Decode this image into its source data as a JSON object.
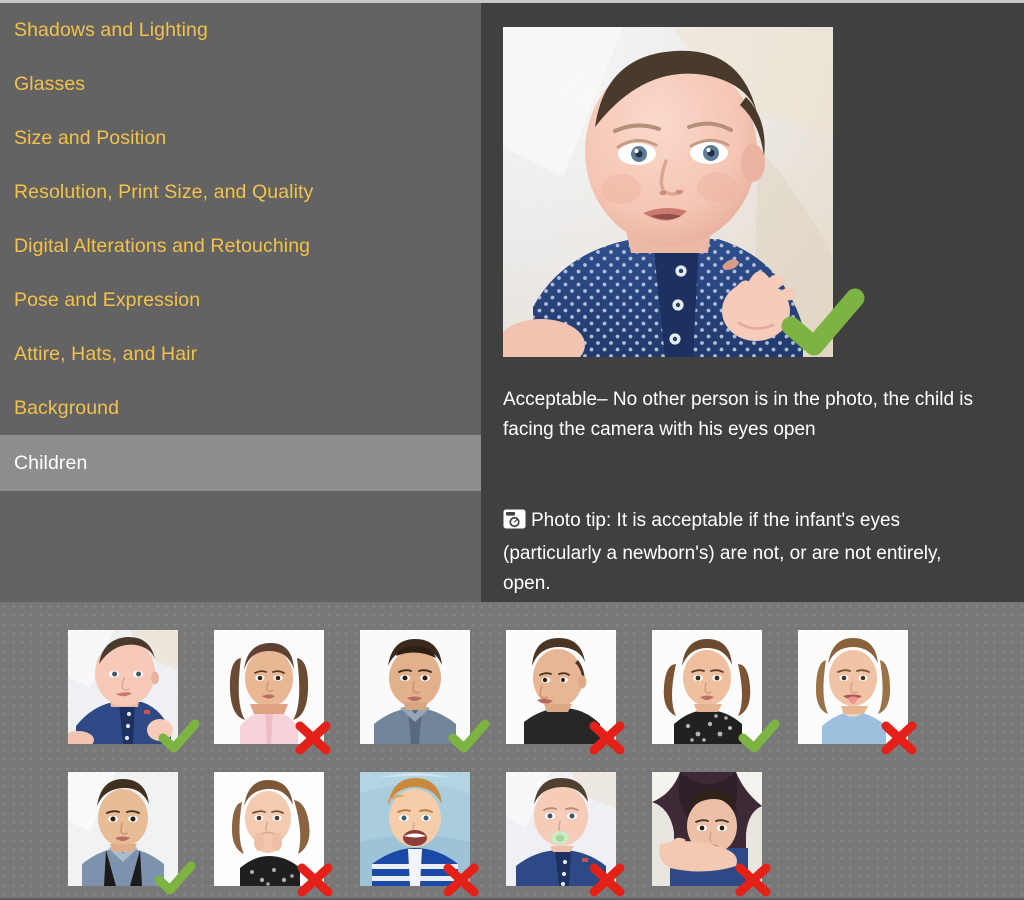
{
  "colors": {
    "sidebar_bg": "#636363",
    "sidebar_link": "#f3c24a",
    "active_bg": "#8d8d8d",
    "active_text": "#ffffff",
    "detail_bg": "#404040",
    "strip_bg": "#787878",
    "check_green": "#7cb342",
    "cross_red": "#e32119",
    "body_text": "#ffffff"
  },
  "sidebar": {
    "items": [
      {
        "label": "Shadows and Lighting",
        "active": false
      },
      {
        "label": "Glasses",
        "active": false
      },
      {
        "label": "Size and Position",
        "active": false
      },
      {
        "label": "Resolution, Print Size, and Quality",
        "active": false
      },
      {
        "label": "Digital Alterations and Retouching",
        "active": false
      },
      {
        "label": "Pose and Expression",
        "active": false
      },
      {
        "label": "Attire, Hats, and Hair",
        "active": false
      },
      {
        "label": "Background",
        "active": false
      },
      {
        "label": "Children",
        "active": true
      }
    ]
  },
  "detail": {
    "photo": {
      "alt": "Infant lying on white sheet wearing a blue polka-dot polo, facing camera with eyes open",
      "verdict_icon": "check-icon",
      "verdict": "acceptable"
    },
    "caption": "Acceptable– No other person is in the photo, the child is facing the camera with his eyes open",
    "tip_icon": "camera-icon",
    "tip": "Photo tip: It is acceptable if the infant's eyes (particularly a newborn's) are not, or are not entirely, open."
  },
  "thumbnails": {
    "row1": [
      {
        "alt": "Infant in blue polka-dot polo lying on white sheet",
        "mark": "check-icon",
        "verdict": "acceptable"
      },
      {
        "alt": "Girl with long brown hair in pink hoodie",
        "mark": "cross-icon",
        "verdict": "unacceptable"
      },
      {
        "alt": "Toddler boy in grey denim shirt",
        "mark": "check-icon",
        "verdict": "acceptable"
      },
      {
        "alt": "Toddler boy in black shirt looking to the side",
        "mark": "cross-icon",
        "verdict": "unacceptable"
      },
      {
        "alt": "Girl with pigtails in black sequin top",
        "mark": "check-icon",
        "verdict": "acceptable"
      },
      {
        "alt": "Girl in blue tank top sticking out her tongue",
        "mark": "cross-icon",
        "verdict": "unacceptable"
      }
    ],
    "row2": [
      {
        "alt": "Toddler boy in blue shirt with black suspenders",
        "mark": "check-icon",
        "verdict": "acceptable"
      },
      {
        "alt": "Girl in black top covering her mouth with her hands",
        "mark": "cross-icon",
        "verdict": "unacceptable"
      },
      {
        "alt": "Baby in blue striped sweater in a car seat, mouth open",
        "mark": "cross-icon",
        "verdict": "unacceptable"
      },
      {
        "alt": "Infant in blue polo with a pacifier in his mouth",
        "mark": "cross-icon",
        "verdict": "unacceptable"
      },
      {
        "alt": "Infant held in an adult's arms",
        "mark": "cross-icon",
        "verdict": "unacceptable"
      }
    ]
  }
}
